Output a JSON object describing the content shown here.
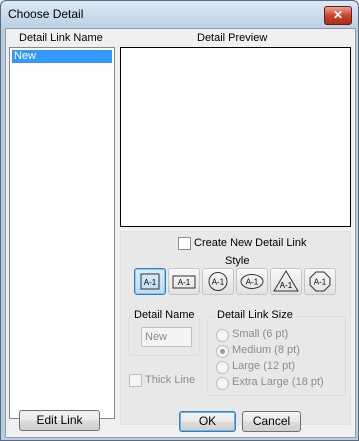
{
  "window": {
    "title": "Choose Detail",
    "close_glyph": "✕"
  },
  "left": {
    "header": "Detail Link Name",
    "items": [
      {
        "label": "New",
        "selected": true
      }
    ]
  },
  "preview": {
    "header": "Detail Preview"
  },
  "create_new": {
    "label": "Create New Detail Link",
    "checked": false
  },
  "style": {
    "title": "Style",
    "options": [
      {
        "text": "A-1",
        "shape": "square",
        "selected": true
      },
      {
        "text": "A-1",
        "shape": "rectangle",
        "selected": false
      },
      {
        "text": "A-1",
        "shape": "circle",
        "selected": false
      },
      {
        "text": "A-1",
        "shape": "ellipse",
        "selected": false
      },
      {
        "text": "A-1",
        "shape": "triangle",
        "selected": false
      },
      {
        "text": "A-1",
        "shape": "octagon",
        "selected": false
      }
    ]
  },
  "detail_name": {
    "title": "Detail Name",
    "value": "New"
  },
  "thick_line": {
    "label": "Thick Line",
    "checked": false
  },
  "link_size": {
    "title": "Detail Link Size",
    "options": [
      {
        "label": "Small (6 pt)",
        "selected": false
      },
      {
        "label": "Medium (8 pt)",
        "selected": true
      },
      {
        "label": "Large (12 pt)",
        "selected": false
      },
      {
        "label": "Extra Large (18 pt)",
        "selected": false
      }
    ]
  },
  "buttons": {
    "edit_link": "Edit Link",
    "ok": "OK",
    "cancel": "Cancel"
  },
  "colors": {
    "accent": "#3399ff",
    "title_bar": "#bcd0e4",
    "close": "#c8442e"
  }
}
